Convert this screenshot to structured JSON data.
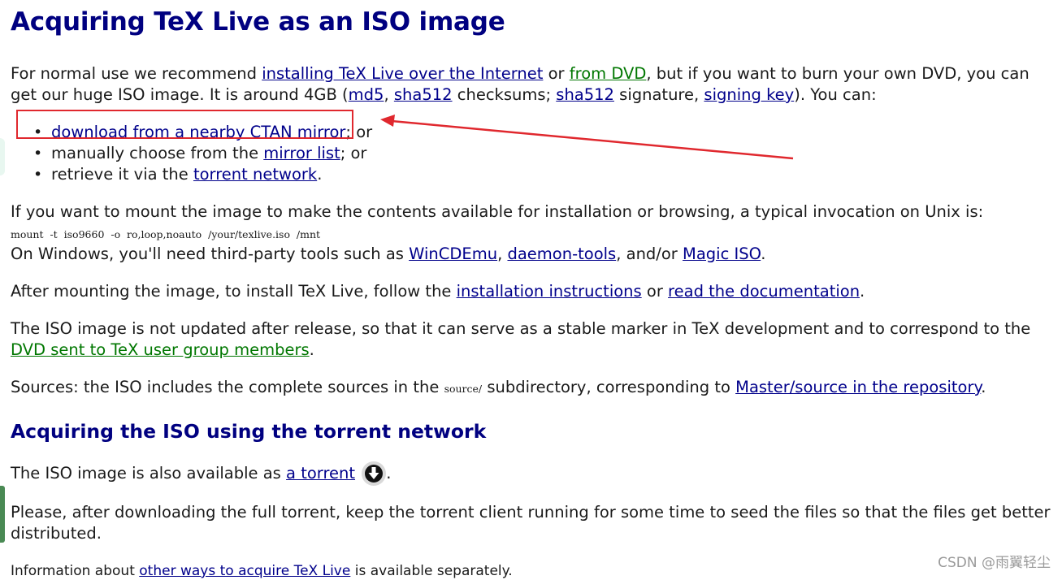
{
  "title": "Acquiring TeX Live as an ISO image",
  "intro": {
    "t1": "For normal use we recommend ",
    "link_internet": "installing TeX Live over the Internet",
    "t2": " or ",
    "link_dvd": "from DVD",
    "t3": ", but if you want to burn your own DVD, you can get our huge ISO image. It is around 4GB (",
    "link_md5": "md5",
    "t4": ", ",
    "link_sha512": "sha512",
    "t5": " checksums; ",
    "link_sha512_sig": "sha512",
    "t6": " signature, ",
    "link_signing_key": "signing key",
    "t7": "). You can:"
  },
  "options": [
    {
      "before": "",
      "link": "download from a nearby CTAN mirror",
      "after": "; or"
    },
    {
      "before": "manually choose from the ",
      "link": "mirror list",
      "after": "; or"
    },
    {
      "before": "retrieve it via the ",
      "link": "torrent network",
      "after": "."
    }
  ],
  "mount": {
    "text": "If you want to mount the image to make the contents available for installation or browsing, a typical invocation on Unix is:",
    "command": "mount  -t  iso9660  -o  ro,loop,noauto  /your/texlive.iso  /mnt",
    "windows_t1": "On Windows, you'll need third-party tools such as ",
    "link_wincdemu": "WinCDEmu",
    "windows_t2": ", ",
    "link_daemon": "daemon-tools",
    "windows_t3": ", and/or ",
    "link_magic": "Magic ISO",
    "windows_t4": "."
  },
  "after_mount": {
    "t1": "After mounting the image, to install TeX Live, follow the ",
    "link_instructions": "installation instructions",
    "t2": " or ",
    "link_docs": "read the documentation",
    "t3": "."
  },
  "not_updated": {
    "t1": "The ISO image is not updated after release, so that it can serve as a stable marker in TeX development and to correspond to the ",
    "link_dvd_members": "DVD sent to TeX user group members",
    "t2": "."
  },
  "sources": {
    "t1": "Sources: the ISO includes the complete sources in the ",
    "code": "source/",
    "t2": " subdirectory, corresponding to ",
    "link_repo": "Master/source in the repository",
    "t3": "."
  },
  "torrent_heading": "Acquiring the ISO using the torrent network",
  "torrent": {
    "t1": "The ISO image is also available as ",
    "link_torrent": "a torrent",
    "t2": ".",
    "icon": "download-circle-icon"
  },
  "seed_text": "Please, after downloading the full torrent, keep the torrent client running for some time to seed the files so that the files get better distributed.",
  "other_ways": {
    "t1": "Information about ",
    "link": "other ways to acquire TeX Live",
    "t2": " is available separately."
  },
  "watermark": "CSDN @雨翼轻尘",
  "colors": {
    "heading": "#000080",
    "link": "#00008b",
    "green_link": "#007700",
    "annotation_red": "#e0282e"
  }
}
